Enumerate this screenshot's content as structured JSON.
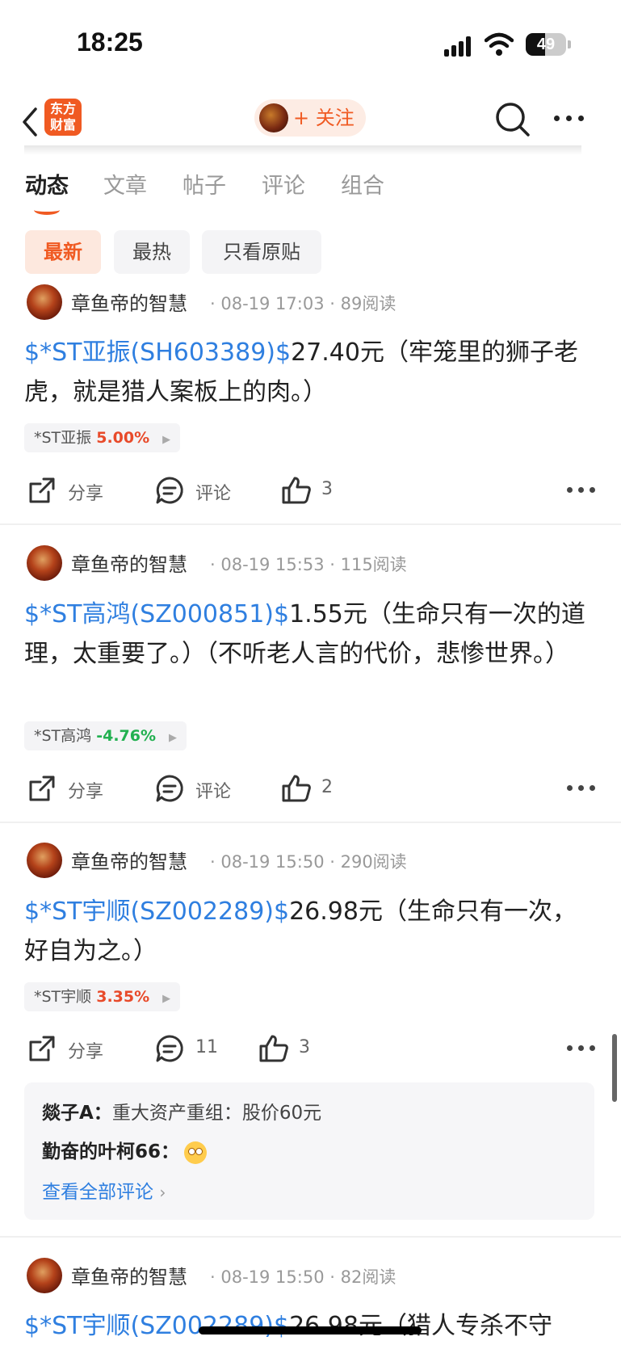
{
  "status": {
    "time": "18:25",
    "battery": "49"
  },
  "nav": {
    "logo_text": "东方财富",
    "follow_label": "+ 关注"
  },
  "tabs": [
    "动态",
    "文章",
    "帖子",
    "评论",
    "组合"
  ],
  "filters": [
    "最新",
    "最热",
    "只看原贴"
  ],
  "posts": [
    {
      "author": "章鱼帝的智慧",
      "meta": "· 08-19 17:03 · 89阅读",
      "stock_link": "$*ST亚振(SH603389)$",
      "text": "27.40元（牢笼里的狮子老虎，就是猎人案板上的肉。）",
      "chip_name": "*ST亚振",
      "chip_change": "5.00%",
      "share": "分享",
      "comment": "评论",
      "likes": "3"
    },
    {
      "author": "章鱼帝的智慧",
      "meta": "· 08-19 15:53 · 115阅读",
      "stock_link": "$*ST高鸿(SZ000851)$",
      "text": "1.55元（生命只有一次的道理，太重要了。）（不听老人言的代价，悲惨世界。）",
      "chip_name": "*ST高鸿",
      "chip_change": "-4.76%",
      "share": "分享",
      "comment": "评论",
      "likes": "2"
    },
    {
      "author": "章鱼帝的智慧",
      "meta": "· 08-19 15:50 · 290阅读",
      "stock_link": "$*ST宇顺(SZ002289)$",
      "text": "26.98元（生命只有一次，好自为之。）",
      "chip_name": "*ST宇顺",
      "chip_change": "3.35%",
      "share": "分享",
      "comment": "11",
      "likes": "3"
    },
    {
      "author": "章鱼帝的智慧",
      "meta": "· 08-19 15:50 · 82阅读",
      "stock_link": "$*ST宇顺(SZ002289)$",
      "text": "26.98元（猎人专杀不守"
    }
  ],
  "comments": [
    {
      "name": "燚子A：",
      "text": "重大资产重组：股价60元"
    },
    {
      "name": "勤奋的叶柯66：",
      "text": ""
    }
  ],
  "view_all_comments": "查看全部评论",
  "colors": {
    "accent": "#f05a22",
    "link": "#2f7fe0",
    "up": "#e84a2a",
    "down": "#22b050"
  }
}
